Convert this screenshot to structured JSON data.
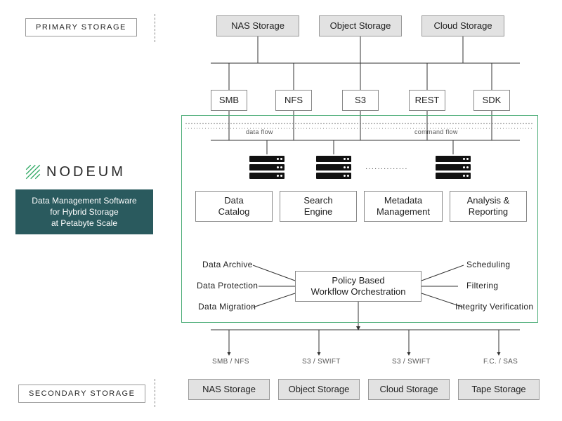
{
  "brand": {
    "name": "NODEUM"
  },
  "tagline": "Data Management Software\nfor Hybrid Storage\nat Petabyte Scale",
  "sections": {
    "primary": "PRIMARY STORAGE",
    "secondary": "SECONDARY STORAGE"
  },
  "primary_storage": [
    "NAS Storage",
    "Object Storage",
    "Cloud Storage"
  ],
  "protocols": [
    "SMB",
    "NFS",
    "S3",
    "REST",
    "SDK"
  ],
  "flow_labels": {
    "data": "data flow",
    "command": "command flow"
  },
  "modules": [
    "Data\nCatalog",
    "Search\nEngine",
    "Metadata\nManagement",
    "Analysis &\nReporting"
  ],
  "orchestration": {
    "title": "Policy Based\nWorkflow Orchestration",
    "left": [
      "Data Archive",
      "Data Protection",
      "Data Migration"
    ],
    "right": [
      "Scheduling",
      "Filtering",
      "Integrity Verification"
    ]
  },
  "secondary_protocols": [
    "SMB / NFS",
    "S3 / SWIFT",
    "S3 / SWIFT",
    "F.C. / SAS"
  ],
  "secondary_storage": [
    "NAS Storage",
    "Object Storage",
    "Cloud Storage",
    "Tape Storage"
  ]
}
